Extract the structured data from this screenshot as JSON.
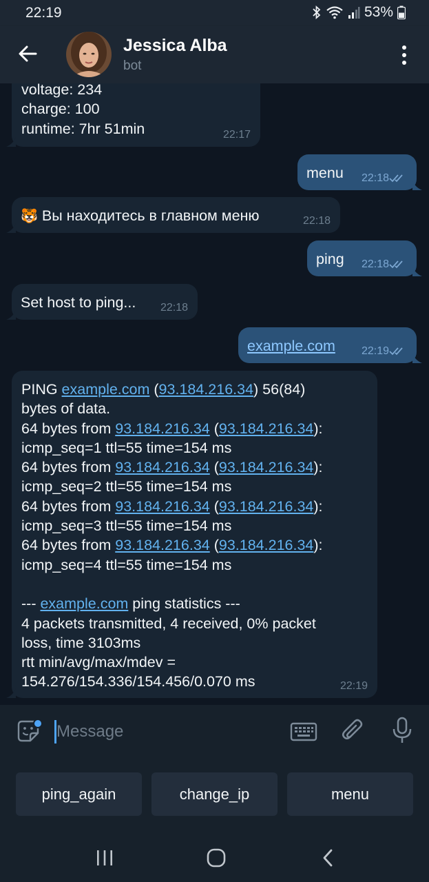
{
  "status_bar": {
    "time": "22:19",
    "battery": "53%"
  },
  "header": {
    "title": "Jessica Alba",
    "subtitle": "bot"
  },
  "messages": [
    {
      "dir": "in",
      "lines": [
        "voltage: 234",
        "charge: 100",
        "runtime: 7hr 51min"
      ],
      "time": "22:17"
    },
    {
      "dir": "out",
      "text": "menu",
      "time": "22:18"
    },
    {
      "dir": "in",
      "emoji": "🐯",
      "text": "Вы находитесь в главном меню",
      "time": "22:18"
    },
    {
      "dir": "out",
      "text": "ping",
      "time": "22:18"
    },
    {
      "dir": "in",
      "text": "Set host to ping...",
      "time": "22:18"
    },
    {
      "dir": "out",
      "text": "example.com",
      "time": "22:19"
    },
    {
      "dir": "in",
      "time": "22:19",
      "ping": {
        "p1": "PING ",
        "host": "example.com",
        "p2": " (",
        "ip": "93.184.216.34",
        "p3": ") 56(84)",
        "p4": "bytes of data.",
        "from": "64 bytes from ",
        "open": " (",
        "close": "):",
        "seq1": "icmp_seq=1 ttl=55 time=154 ms",
        "seq2": "icmp_seq=2 ttl=55 time=154 ms",
        "seq3": "icmp_seq=3 ttl=55 time=154 ms",
        "seq4": "icmp_seq=4 ttl=55 time=154 ms",
        "stat_pre": "--- ",
        "stat_post": " ping statistics ---",
        "tx1": "4 packets transmitted, 4 received, 0% packet",
        "tx2": "loss, time 3103ms",
        "rtt1": "rtt min/avg/max/mdev =",
        "rtt2": "154.276/154.336/154.456/0.070 ms"
      }
    }
  ],
  "input": {
    "placeholder": "Message"
  },
  "bot_keyboard": [
    "ping_again",
    "change_ip",
    "menu"
  ],
  "colors": {
    "bg": "#0e1621",
    "incoming": "#182533",
    "outgoing": "#2b5278",
    "link": "#62b2ef",
    "header": "#1d2733"
  },
  "icons": {
    "back": "arrow-left-icon",
    "more": "more-vertical-icon",
    "emoji": "sticker-icon",
    "keyboard": "keyboard-icon",
    "attach": "paperclip-icon",
    "mic": "microphone-icon"
  }
}
